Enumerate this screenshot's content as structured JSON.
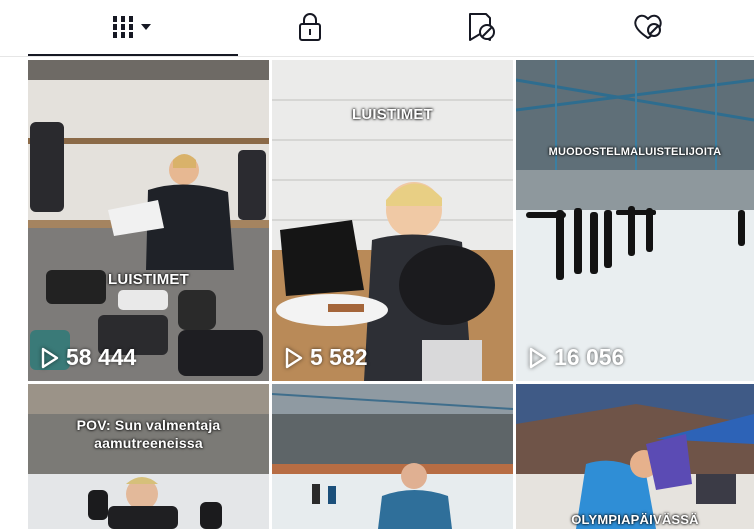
{
  "tabs": [
    {
      "name": "videos",
      "icon": "grid-icon",
      "active": true
    },
    {
      "name": "private",
      "icon": "lock-icon",
      "active": false
    },
    {
      "name": "reposts",
      "icon": "repost-icon",
      "active": false
    },
    {
      "name": "liked",
      "icon": "heart-hidden-icon",
      "active": false
    }
  ],
  "videos": [
    {
      "caption": "LUISTIMET",
      "views": "58 444"
    },
    {
      "caption": "LUISTIMET",
      "views": "5 582"
    },
    {
      "caption": "MUODOSTELMALUISTELIJOITA",
      "views": "16 056"
    },
    {
      "caption_line1": "POV: Sun valmentaja",
      "caption_line2": "aamutreeneissa"
    },
    {
      "caption": ""
    },
    {
      "caption": "OLYMPIAPÄIVÄSSÄ"
    }
  ],
  "colors": {
    "text": "#161823",
    "tab_icon": "#161823",
    "overlay_text": "#ffffff"
  }
}
